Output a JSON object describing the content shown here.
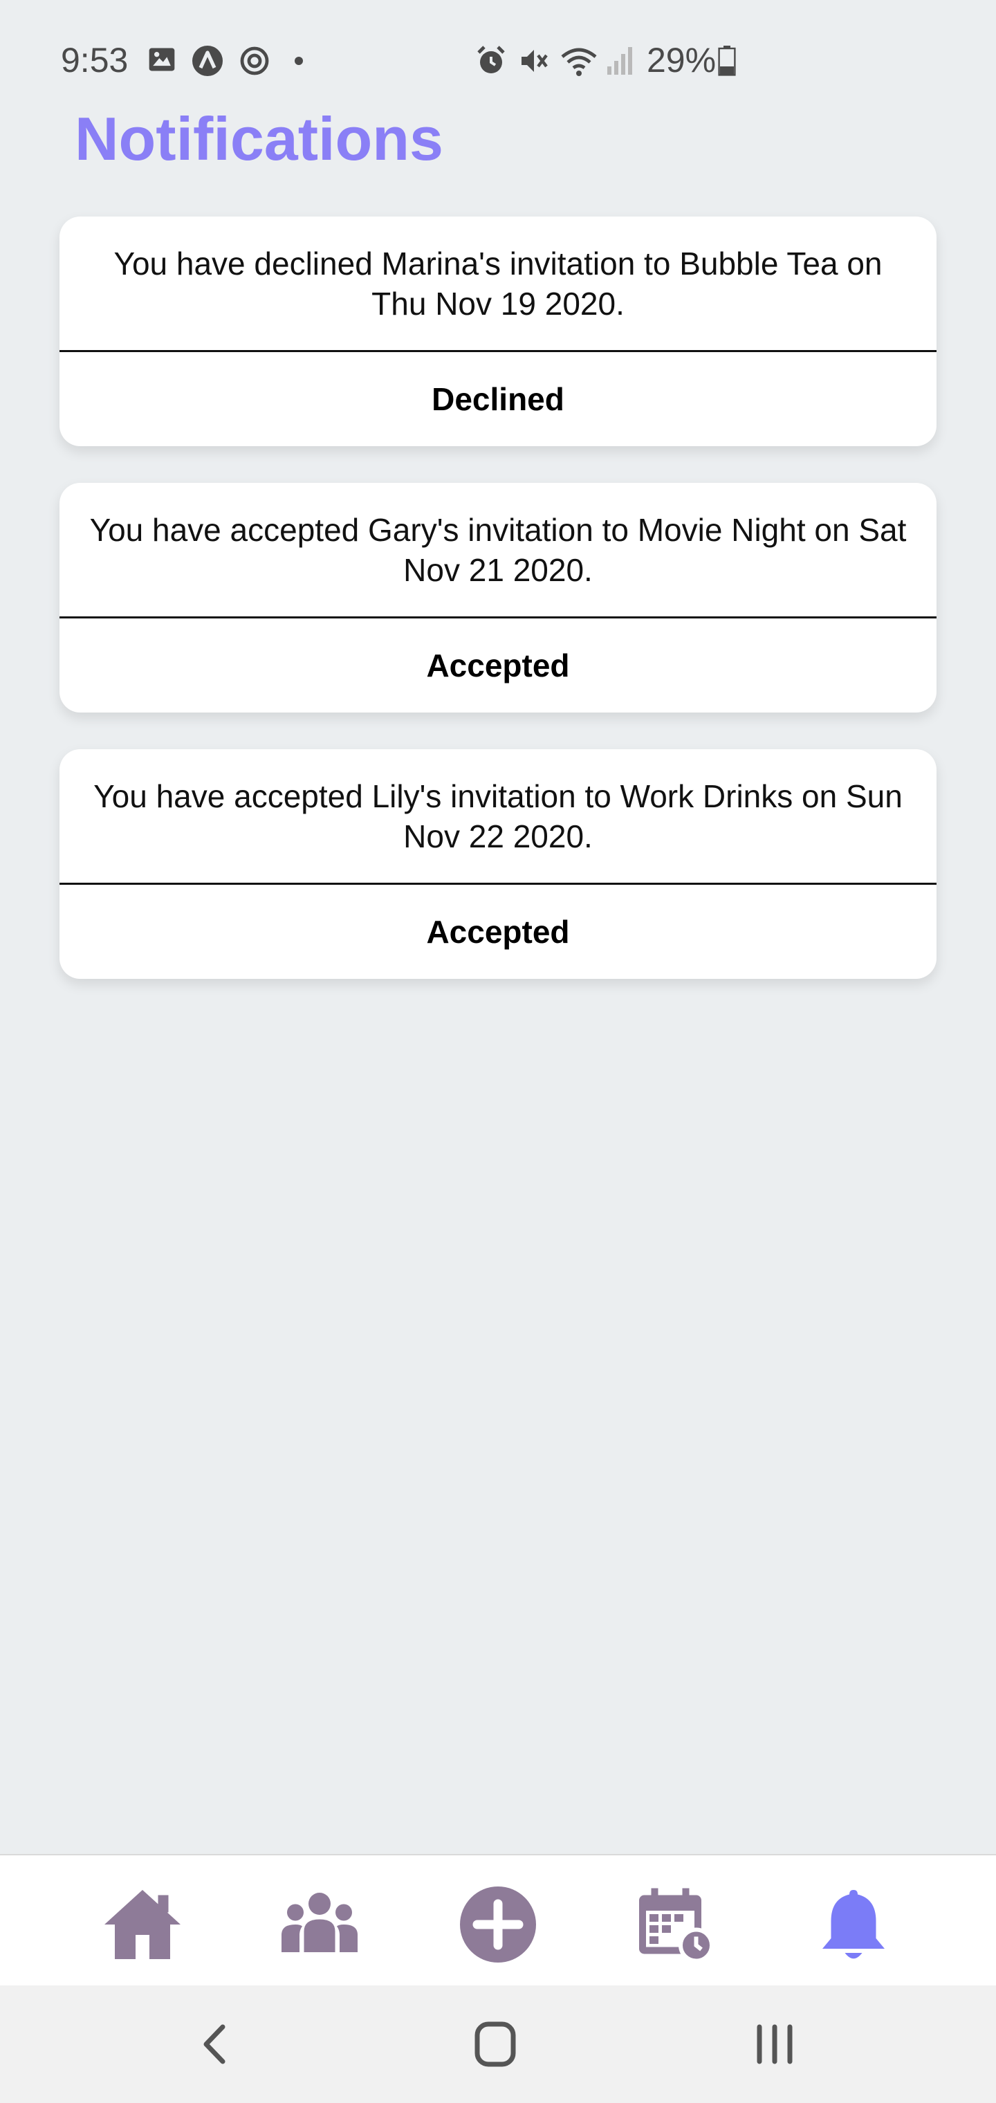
{
  "status_bar": {
    "time": "9:53",
    "battery_percent": "29%",
    "icons": [
      "gallery-icon",
      "app-icon",
      "sync-icon",
      "dot-icon",
      "alarm-icon",
      "mute-icon",
      "wifi-icon",
      "signal-icon",
      "battery-icon"
    ]
  },
  "header": {
    "title": "Notifications"
  },
  "notifications": [
    {
      "message": "You have declined Marina's invitation to Bubble Tea on Thu Nov 19 2020.",
      "status": "Declined"
    },
    {
      "message": "You have accepted Gary's invitation to Movie Night on Sat Nov 21 2020.",
      "status": "Accepted"
    },
    {
      "message": "You have accepted Lily's invitation to Work Drinks on Sun Nov 22 2020.",
      "status": "Accepted"
    }
  ],
  "tab_bar": {
    "tabs": [
      {
        "icon": "home-icon",
        "active": false
      },
      {
        "icon": "friends-icon",
        "active": false
      },
      {
        "icon": "add-icon",
        "active": false
      },
      {
        "icon": "calendar-icon",
        "active": false
      },
      {
        "icon": "bell-icon",
        "active": true
      }
    ],
    "inactive_color": "#8e7b98",
    "active_color": "#7b7cf7"
  },
  "system_nav": {
    "buttons": [
      "back-icon",
      "home-circle-icon",
      "recents-icon"
    ]
  },
  "colors": {
    "background": "#ebeef0",
    "accent": "#8a7ff6",
    "card": "#ffffff"
  }
}
